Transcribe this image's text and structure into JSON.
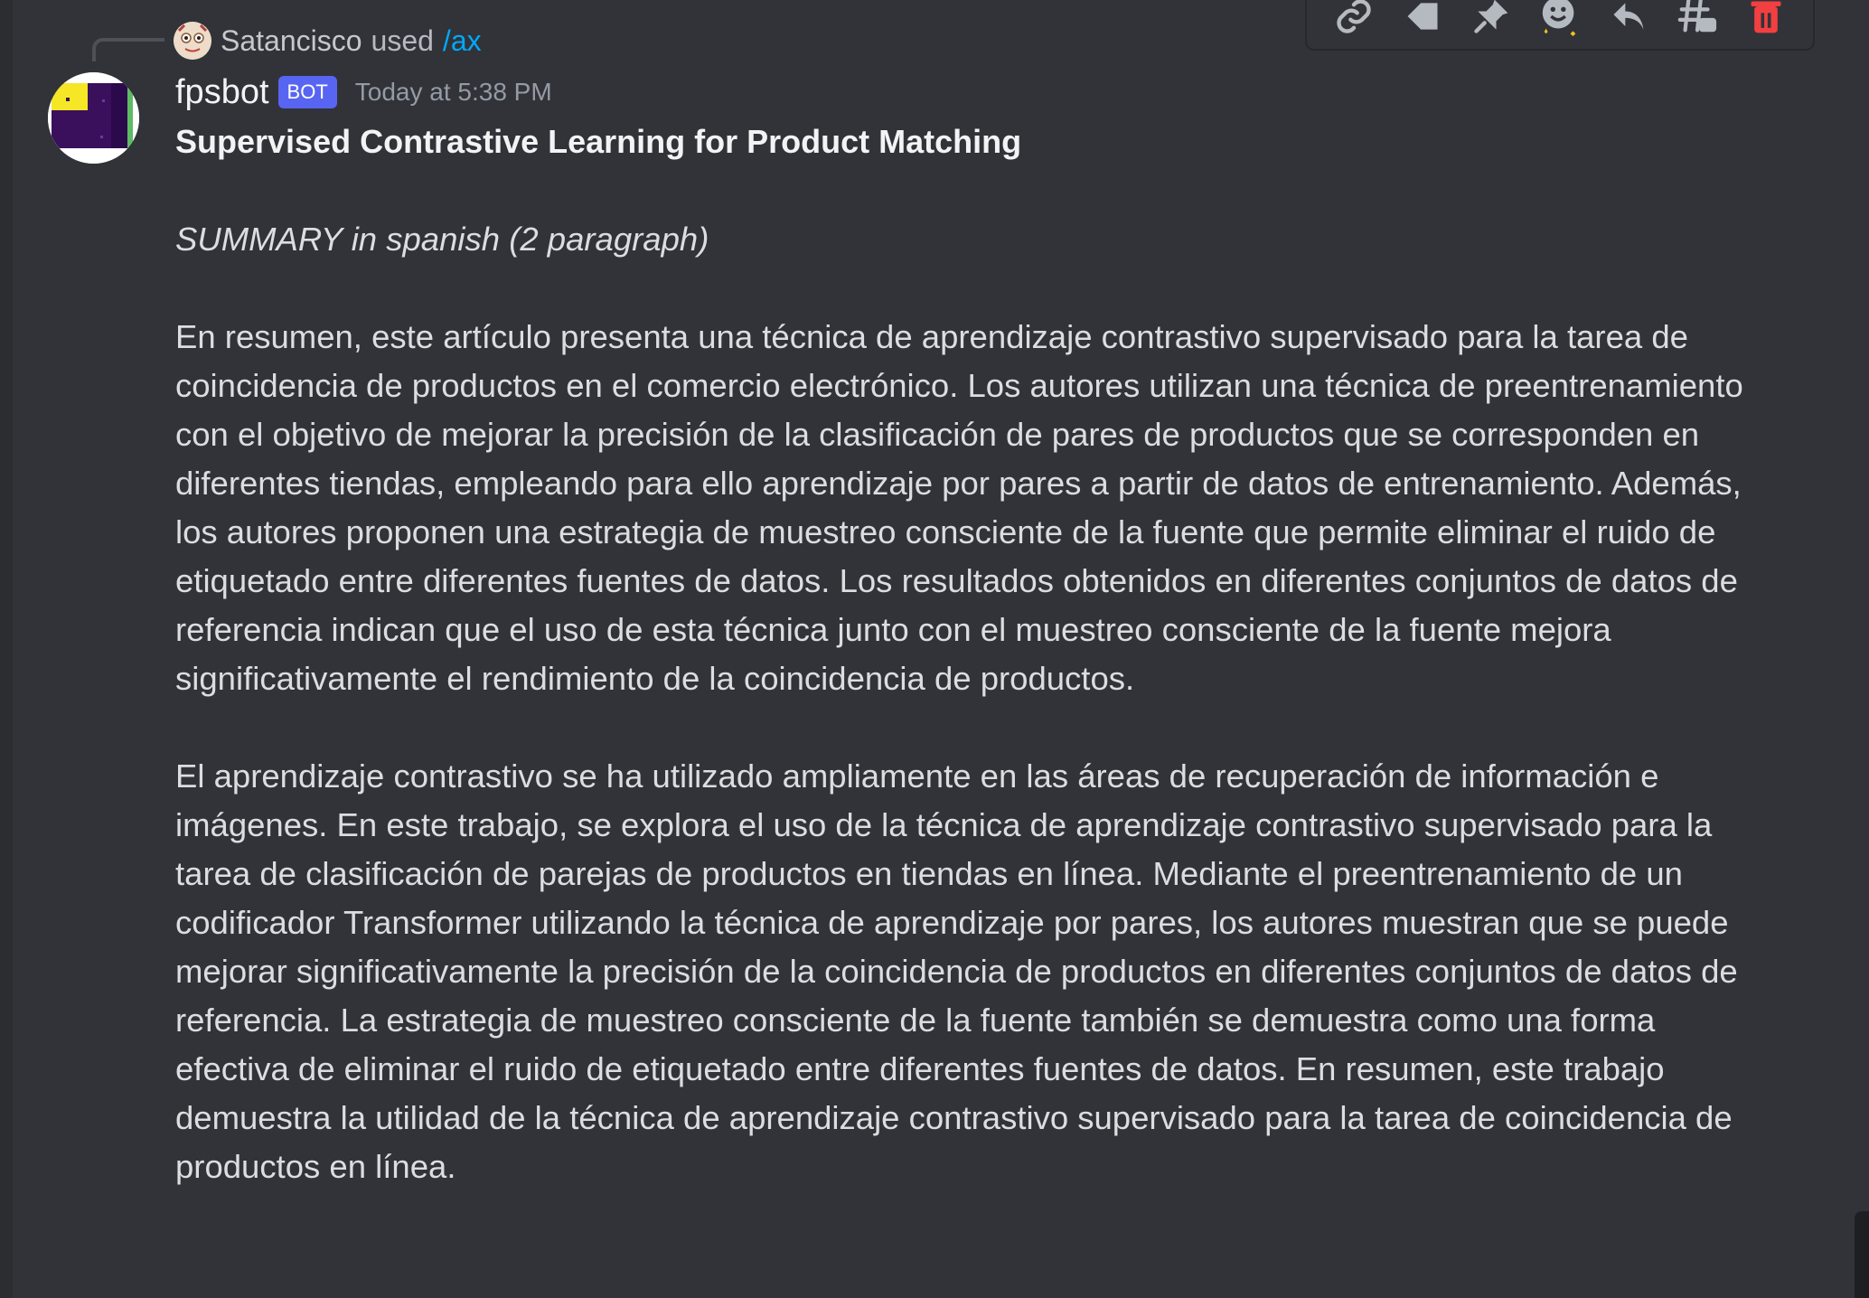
{
  "toolbar": {
    "items": [
      "link-icon",
      "tag-icon",
      "pin-icon",
      "add-reaction-icon",
      "reply-icon",
      "create-thread-icon",
      "delete-icon"
    ],
    "colors": {
      "icon": "#b5bac1",
      "danger": "#f23f42"
    }
  },
  "reply": {
    "user": "Satancisco",
    "used": "used",
    "command": "/ax"
  },
  "message": {
    "author": "fpsbot",
    "badge": "BOT",
    "timestamp": "Today at 5:38 PM",
    "title": "Supervised Contrastive Learning for Product Matching",
    "subtitle": "SUMMARY in spanish (2 paragraph)",
    "paragraph1": "En resumen, este artículo presenta una técnica de aprendizaje contrastivo supervisado para la tarea de coincidencia de productos en el comercio electrónico. Los autores utilizan una técnica de preentrenamiento con el objetivo de mejorar la precisión de la clasificación de pares de productos que se corresponden en diferentes tiendas, empleando para ello aprendizaje por pares a partir de datos de entrenamiento. Además, los autores proponen una estrategia de muestreo consciente de la fuente que permite eliminar el ruido de etiquetado entre diferentes fuentes de datos. Los resultados obtenidos en diferentes conjuntos de datos de referencia indican que el uso de esta técnica junto con el muestreo consciente de la fuente mejora significativamente el rendimiento de la coincidencia de productos.",
    "paragraph2": "El aprendizaje contrastivo se ha utilizado ampliamente en las áreas de recuperación de información e imágenes. En este trabajo, se explora el uso de la técnica de aprendizaje contrastivo supervisado para la tarea de clasificación de parejas de productos en tiendas en línea. Mediante el preentrenamiento de un codificador Transformer utilizando la técnica de aprendizaje por pares, los autores muestran que se puede mejorar significativamente la precisión de la coincidencia de productos en diferentes conjuntos de datos de referencia. La estrategia de muestreo consciente de la fuente también se demuestra como una forma efectiva de eliminar el ruido de etiquetado entre diferentes fuentes de datos. En resumen, este trabajo demuestra la utilidad de la técnica de aprendizaje contrastivo supervisado para la tarea de coincidencia de productos en línea."
  },
  "colors": {
    "background": "#313338",
    "text": "#dbdee1",
    "command_link": "#00a8fc",
    "bot_badge": "#5865f2"
  }
}
